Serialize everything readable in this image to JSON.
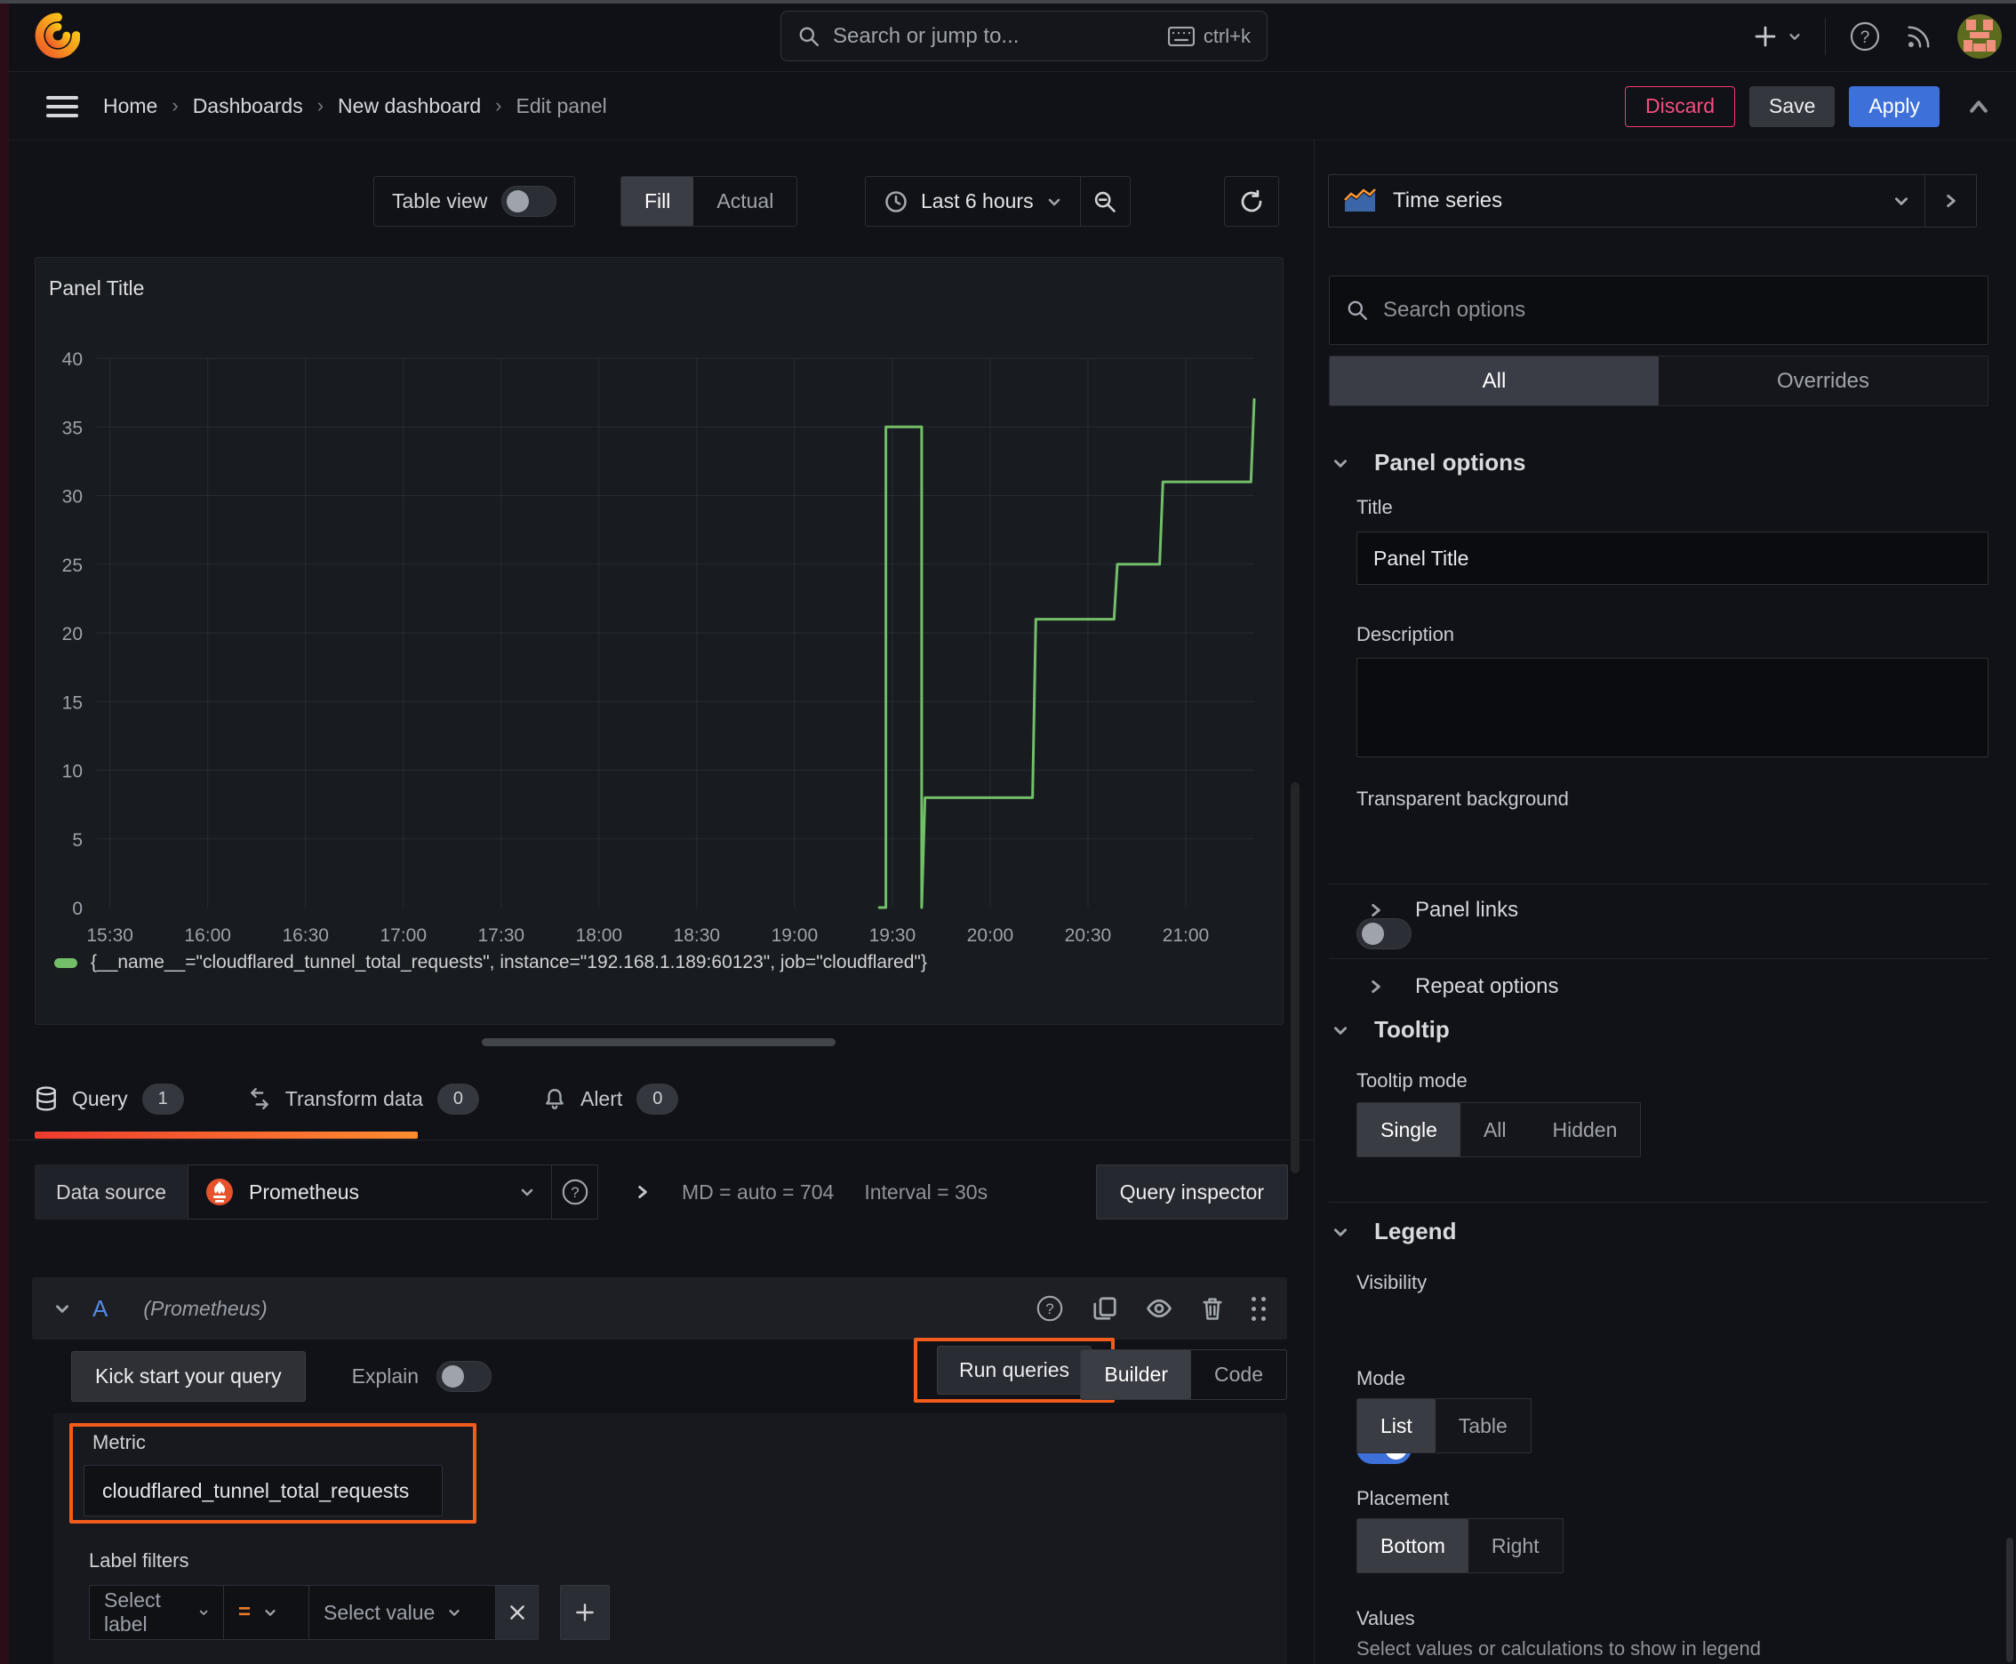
{
  "colors": {
    "annotation": "#f25b1c",
    "series_green": "#73bf69",
    "accent_blue": "#3d71d9",
    "discard_pink": "#f23a72",
    "tab_underline_start": "#ed3b2f",
    "tab_underline_end": "#ff8c2f"
  },
  "topbar": {
    "search_placeholder": "Search or jump to...",
    "shortcut": "ctrl+k"
  },
  "breadcrumb": {
    "items": [
      "Home",
      "Dashboards",
      "New dashboard",
      "Edit panel"
    ]
  },
  "actions": {
    "discard": "Discard",
    "save": "Save",
    "apply": "Apply"
  },
  "view_toolbar": {
    "table_view": "Table view",
    "fill": "Fill",
    "actual": "Actual",
    "time_range": "Last 6 hours"
  },
  "panel": {
    "title": "Panel Title"
  },
  "chart_data": {
    "type": "line",
    "title": "Panel Title",
    "xlabel": "",
    "ylabel": "",
    "x_domain": [
      "15:26",
      "21:21"
    ],
    "ylim": [
      0,
      40
    ],
    "y_ticks": [
      0,
      5,
      10,
      15,
      20,
      25,
      30,
      35,
      40
    ],
    "x_ticks": [
      "15:30",
      "16:00",
      "16:30",
      "17:00",
      "17:30",
      "18:00",
      "18:30",
      "19:00",
      "19:30",
      "20:00",
      "20:30",
      "21:00"
    ],
    "grid": true,
    "legend_position": "bottom",
    "series": [
      {
        "name": "{__name__=\"cloudflared_tunnel_total_requests\", instance=\"192.168.1.189:60123\", job=\"cloudflared\"}",
        "color": "#73bf69",
        "points": [
          [
            "19:26",
            0
          ],
          [
            "19:28",
            0
          ],
          [
            "19:28",
            35
          ],
          [
            "19:39",
            35
          ],
          [
            "19:39",
            0
          ],
          [
            "19:40",
            8
          ],
          [
            "20:13",
            8
          ],
          [
            "20:14",
            21
          ],
          [
            "20:38",
            21
          ],
          [
            "20:39",
            25
          ],
          [
            "20:52",
            25
          ],
          [
            "20:53",
            31
          ],
          [
            "21:20",
            31
          ],
          [
            "21:21",
            37
          ]
        ]
      }
    ]
  },
  "query_tabs": {
    "query": "Query",
    "query_count": "1",
    "transform": "Transform data",
    "transform_count": "0",
    "alert": "Alert",
    "alert_count": "0"
  },
  "datasource_row": {
    "label": "Data source",
    "name": "Prometheus",
    "options_summary": "MD = auto = 704",
    "interval": "Interval = 30s",
    "inspector": "Query inspector"
  },
  "query_a": {
    "ref": "A",
    "hint": "(Prometheus)",
    "kick_start": "Kick start your query",
    "explain": "Explain",
    "run": "Run queries",
    "builder": "Builder",
    "code": "Code",
    "metric_label": "Metric",
    "metric_value": "cloudflared_tunnel_total_requests",
    "label_filters_label": "Label filters",
    "select_label": "Select label",
    "operator": "=",
    "select_value": "Select value"
  },
  "options_pane": {
    "visualization": "Time series",
    "search_placeholder": "Search options",
    "tab_all": "All",
    "tab_overrides": "Overrides",
    "panel_options": {
      "header": "Panel options",
      "title_label": "Title",
      "title_value": "Panel Title",
      "description_label": "Description",
      "description_value": "",
      "transparent_label": "Transparent background",
      "panel_links": "Panel links",
      "repeat_options": "Repeat options"
    },
    "tooltip": {
      "header": "Tooltip",
      "mode_label": "Tooltip mode",
      "single": "Single",
      "all": "All",
      "hidden": "Hidden"
    },
    "legend": {
      "header": "Legend",
      "visibility_label": "Visibility",
      "mode_label": "Mode",
      "list": "List",
      "table": "Table",
      "placement_label": "Placement",
      "bottom": "Bottom",
      "right": "Right",
      "values_label": "Values",
      "values_help": "Select values or calculations to show in legend"
    }
  }
}
